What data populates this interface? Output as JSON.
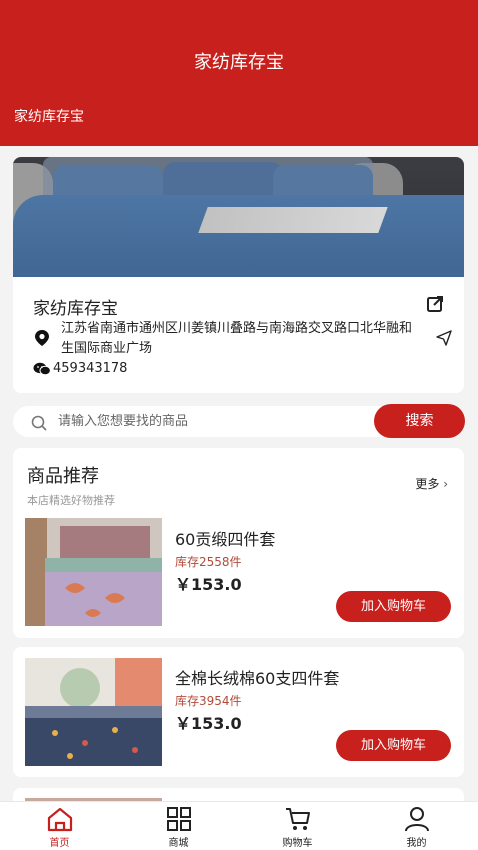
{
  "header": {
    "title": "家纺库存宝",
    "subtitle": "家纺库存宝"
  },
  "store": {
    "name": "家纺库存宝",
    "address": "江苏省南通市通州区川姜镇川叠路与南海路交叉路口北华融和生国际商业广场",
    "wechat": "459343178"
  },
  "search": {
    "placeholder": "请输入您想要找的商品",
    "button": "搜索"
  },
  "recommend": {
    "title": "商品推荐",
    "subtitle": "本店精选好物推荐",
    "more": "更多"
  },
  "products": [
    {
      "name": "60贡缎四件套",
      "stock": "库存2558件",
      "price": "￥153.0",
      "button": "加入购物车"
    },
    {
      "name": "全棉长绒棉60支四件套",
      "stock": "库存3954件",
      "price": "￥153.0",
      "button": "加入购物车"
    }
  ],
  "tabs": [
    {
      "label": "首页",
      "icon": "home-icon"
    },
    {
      "label": "商城",
      "icon": "grid-icon"
    },
    {
      "label": "购物车",
      "icon": "cart-icon"
    },
    {
      "label": "我的",
      "icon": "user-icon"
    }
  ],
  "colors": {
    "brand": "#c8201d",
    "stock": "#b24a3a"
  }
}
